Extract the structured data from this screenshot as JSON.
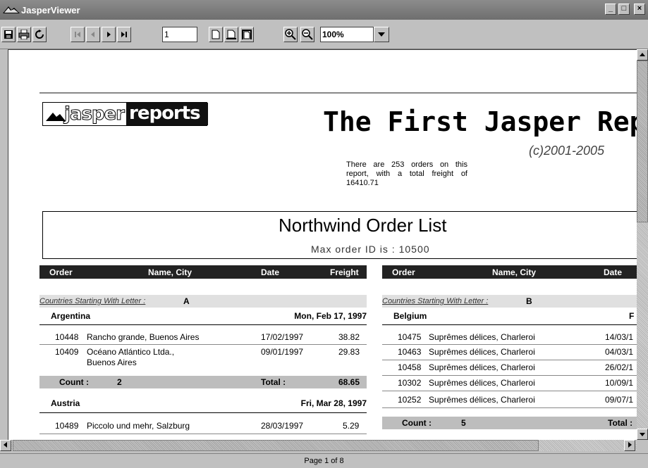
{
  "window": {
    "title": "JasperViewer",
    "controls": {
      "minimize": "_",
      "maximize": "□",
      "close": "×"
    }
  },
  "toolbar": {
    "icons": [
      "save-icon",
      "print-icon",
      "reload-icon",
      "first-page-icon",
      "previous-page-icon",
      "next-page-icon",
      "last-page-icon",
      "actual-size-icon",
      "fit-page-icon",
      "fit-width-icon",
      "zoom-in-icon",
      "zoom-out-icon"
    ],
    "page_number": "1",
    "zoom": "100%"
  },
  "report": {
    "logo": {
      "part1": "jasper",
      "part2": "reports"
    },
    "title": "The First Jasper Report",
    "copyright": "(c)2001-2005",
    "summary": "There are 253 orders on this report, with a total freight of 16410.71",
    "list_title": "Northwind Order List",
    "list_subtitle": "Max order ID is : 10500",
    "columns": {
      "order": "Order",
      "name_city": "Name, City",
      "date": "Date",
      "freight": "Freight"
    },
    "letter_label": "Countries Starting With Letter :",
    "left_column": {
      "letter": "A",
      "groups": [
        {
          "country": "Argentina",
          "date": "Mon, Feb 17, 1997",
          "rows": [
            {
              "order": "10448",
              "name": "Rancho grande, Buenos Aires",
              "name2": "",
              "date": "17/02/1997",
              "freight": "38.82"
            },
            {
              "order": "10409",
              "name": "Océano Atlántico Ltda.,",
              "name2": "Buenos Aires",
              "date": "09/01/1997",
              "freight": "29.83"
            }
          ],
          "count_label": "Count :",
          "count": "2",
          "total_label": "Total :",
          "total": "68.65"
        },
        {
          "country": "Austria",
          "date": "Fri, Mar 28, 1997",
          "rows": [
            {
              "order": "10489",
              "name": "Piccolo und mehr, Salzburg",
              "name2": "",
              "date": "28/03/1997",
              "freight": "5.29"
            }
          ]
        }
      ]
    },
    "right_column": {
      "letter": "B",
      "groups": [
        {
          "country": "Belgium",
          "date_partial": "F",
          "rows": [
            {
              "order": "10475",
              "name": "Suprêmes délices, Charleroi",
              "date": "14/03/1"
            },
            {
              "order": "10463",
              "name": "Suprêmes délices, Charleroi",
              "date": "04/03/1"
            },
            {
              "order": "10458",
              "name": "Suprêmes délices, Charleroi",
              "date": "26/02/1"
            },
            {
              "order": "10302",
              "name": "Suprêmes délices, Charleroi",
              "date": "10/09/1"
            },
            {
              "order": "10252",
              "name": "Suprêmes délices, Charleroi",
              "date": "09/07/1"
            }
          ],
          "count_label": "Count :",
          "count": "5",
          "total_label": "Total :"
        }
      ]
    }
  },
  "status": {
    "page_info": "Page 1 of 8"
  }
}
